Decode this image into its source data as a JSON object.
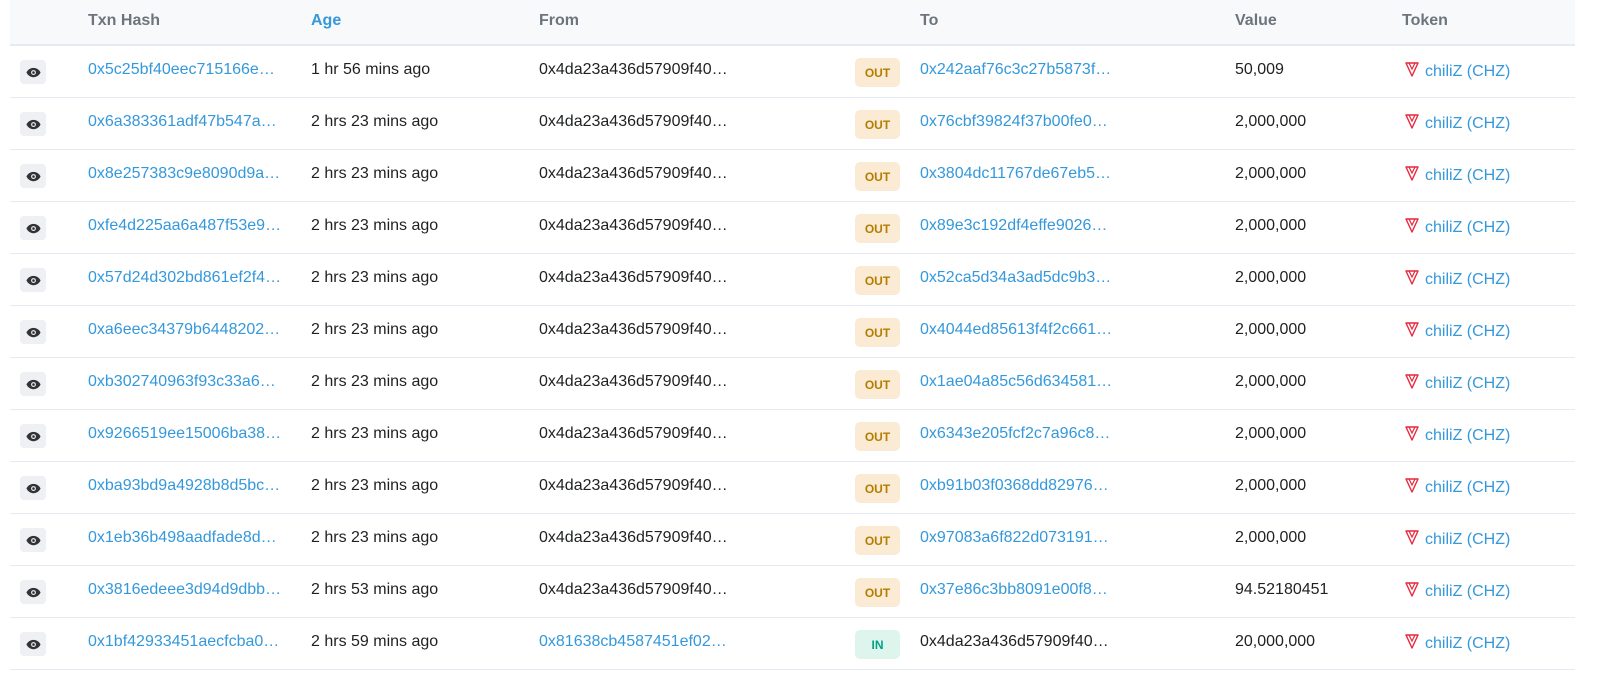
{
  "colors": {
    "link": "#3498db",
    "out_badge_bg": "#fbebd4",
    "out_badge_text": "#b47d00",
    "in_badge_bg": "#def5ee",
    "in_badge_text": "#00a186",
    "token_logo": "#e8273a"
  },
  "headers": {
    "txn_hash": "Txn Hash",
    "age": "Age",
    "from": "From",
    "to": "To",
    "value": "Value",
    "token": "Token"
  },
  "rows": [
    {
      "hash": "0x5c25bf40eec715166e…",
      "age": "1 hr 56 mins ago",
      "from": "0x4da23a436d57909f40…",
      "dir": "OUT",
      "to": "0x242aaf76c3c27b5873f…",
      "value": "50,009",
      "token": "chiliZ (CHZ)"
    },
    {
      "hash": "0x6a383361adf47b547a…",
      "age": "2 hrs 23 mins ago",
      "from": "0x4da23a436d57909f40…",
      "dir": "OUT",
      "to": "0x76cbf39824f37b00fe0…",
      "value": "2,000,000",
      "token": "chiliZ (CHZ)"
    },
    {
      "hash": "0x8e257383c9e8090d9a…",
      "age": "2 hrs 23 mins ago",
      "from": "0x4da23a436d57909f40…",
      "dir": "OUT",
      "to": "0x3804dc11767de67eb5…",
      "value": "2,000,000",
      "token": "chiliZ (CHZ)"
    },
    {
      "hash": "0xfe4d225aa6a487f53e9…",
      "age": "2 hrs 23 mins ago",
      "from": "0x4da23a436d57909f40…",
      "dir": "OUT",
      "to": "0x89e3c192df4effe9026…",
      "value": "2,000,000",
      "token": "chiliZ (CHZ)"
    },
    {
      "hash": "0x57d24d302bd861ef2f4…",
      "age": "2 hrs 23 mins ago",
      "from": "0x4da23a436d57909f40…",
      "dir": "OUT",
      "to": "0x52ca5d34a3ad5dc9b3…",
      "value": "2,000,000",
      "token": "chiliZ (CHZ)"
    },
    {
      "hash": "0xa6eec34379b6448202…",
      "age": "2 hrs 23 mins ago",
      "from": "0x4da23a436d57909f40…",
      "dir": "OUT",
      "to": "0x4044ed85613f4f2c661…",
      "value": "2,000,000",
      "token": "chiliZ (CHZ)"
    },
    {
      "hash": "0xb302740963f93c33a6…",
      "age": "2 hrs 23 mins ago",
      "from": "0x4da23a436d57909f40…",
      "dir": "OUT",
      "to": "0x1ae04a85c56d634581…",
      "value": "2,000,000",
      "token": "chiliZ (CHZ)"
    },
    {
      "hash": "0x9266519ee15006ba38…",
      "age": "2 hrs 23 mins ago",
      "from": "0x4da23a436d57909f40…",
      "dir": "OUT",
      "to": "0x6343e205fcf2c7a96c8…",
      "value": "2,000,000",
      "token": "chiliZ (CHZ)"
    },
    {
      "hash": "0xba93bd9a4928b8d5bc…",
      "age": "2 hrs 23 mins ago",
      "from": "0x4da23a436d57909f40…",
      "dir": "OUT",
      "to": "0xb91b03f0368dd82976…",
      "value": "2,000,000",
      "token": "chiliZ (CHZ)"
    },
    {
      "hash": "0x1eb36b498aadfade8d…",
      "age": "2 hrs 23 mins ago",
      "from": "0x4da23a436d57909f40…",
      "dir": "OUT",
      "to": "0x97083a6f822d073191…",
      "value": "2,000,000",
      "token": "chiliZ (CHZ)"
    },
    {
      "hash": "0x3816edeee3d94d9dbb…",
      "age": "2 hrs 53 mins ago",
      "from": "0x4da23a436d57909f40…",
      "dir": "OUT",
      "to": "0x37e86c3bb8091e00f8…",
      "value": "94.52180451",
      "token": "chiliZ (CHZ)"
    },
    {
      "hash": "0x1bf42933451aecfcba0…",
      "age": "2 hrs 59 mins ago",
      "from": "0x81638cb4587451ef02…",
      "dir": "IN",
      "to": "0x4da23a436d57909f40…",
      "value": "20,000,000",
      "token": "chiliZ (CHZ)"
    }
  ]
}
